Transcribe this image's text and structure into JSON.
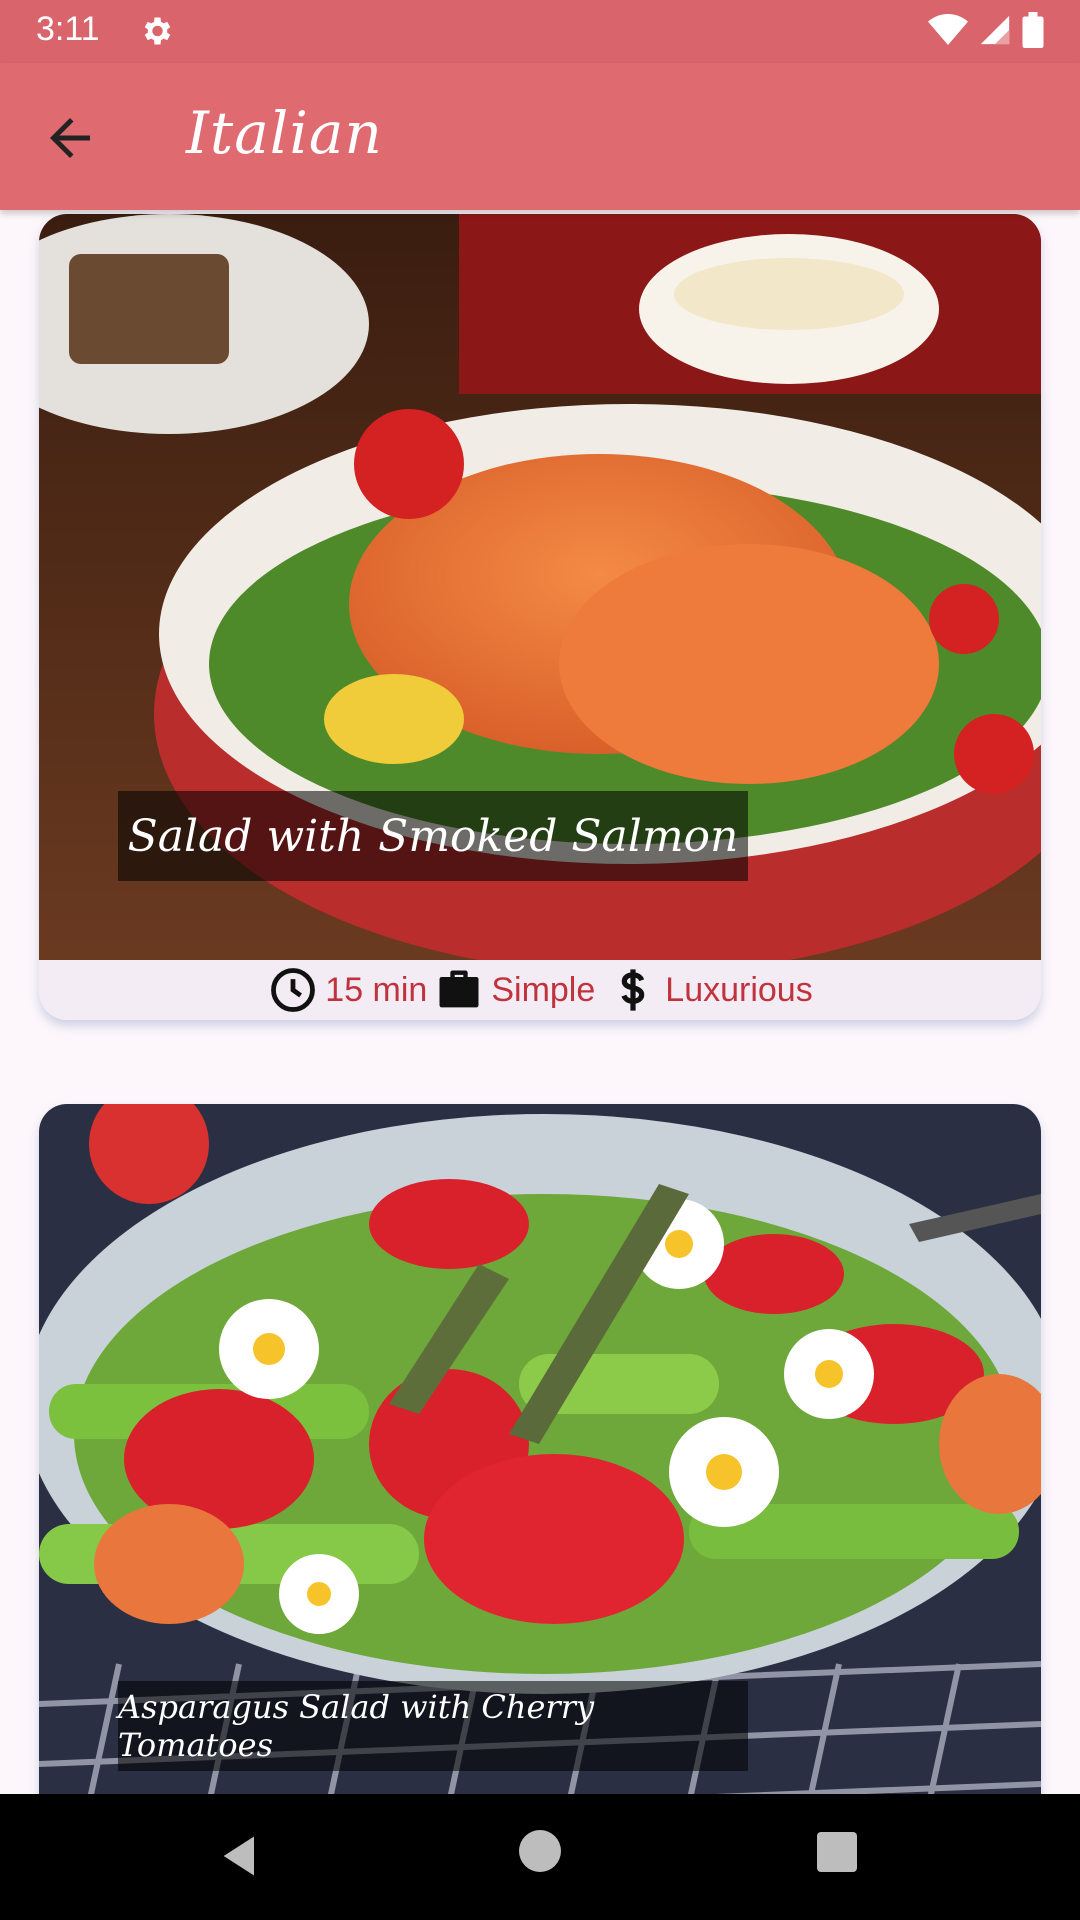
{
  "status_bar": {
    "time": "3:11"
  },
  "app_bar": {
    "title": "Italian"
  },
  "meals": [
    {
      "title": "Salad with Smoked Salmon",
      "duration": "15 min",
      "complexity": "Simple",
      "affordability": "Luxurious"
    },
    {
      "title": "Asparagus Salad with Cherry Tomatoes"
    }
  ],
  "colors": {
    "app_bar": "#df6a70",
    "status_bar": "#d9646c",
    "meta_text": "#c0333d",
    "card_bg": "#f3ecf4"
  },
  "icons": [
    "gear-icon",
    "wifi-icon",
    "signal-icon",
    "battery-icon",
    "back-arrow-icon",
    "clock-icon",
    "briefcase-icon",
    "dollar-icon"
  ]
}
